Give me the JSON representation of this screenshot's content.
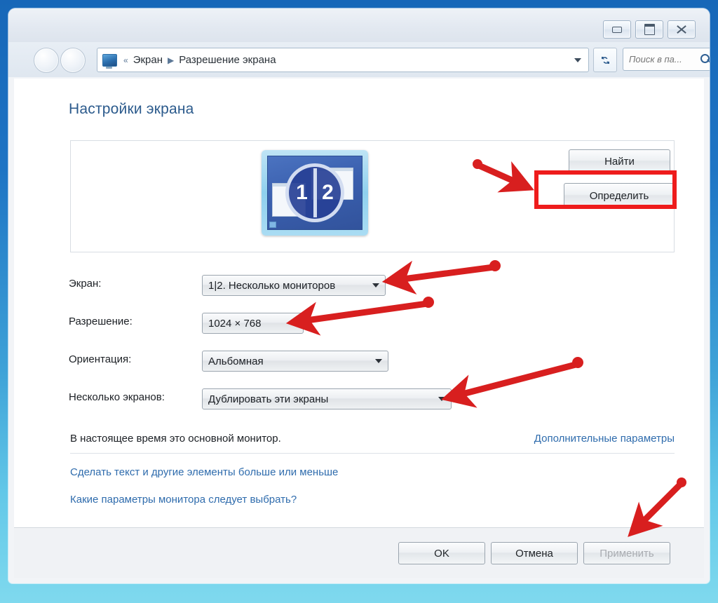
{
  "window": {
    "titlebar": {
      "minimize_label": "Свернуть",
      "maximize_label": "Развернуть",
      "close_label": "Закрыть"
    },
    "nav": {
      "back_label": "Назад",
      "forward_label": "Вперёд",
      "breadcrumb_prefix": "«",
      "breadcrumb": [
        "Экран",
        "Разрешение экрана"
      ],
      "breadcrumb_separator": "▶",
      "refresh_icon": "refresh-icon",
      "address_icon": "display-icon"
    },
    "search": {
      "placeholder": "Поиск в па...",
      "value": "",
      "icon": "search-icon"
    }
  },
  "main": {
    "page_title": "Настройки экрана",
    "preview": {
      "badge_left": "1",
      "badge_right": "2"
    },
    "buttons": {
      "find": "Найти",
      "identify": "Определить"
    },
    "fields": [
      {
        "label": "Экран:",
        "value": "1|2. Несколько мониторов",
        "name": "display-select"
      },
      {
        "label": "Разрешение:",
        "value": "1024 × 768",
        "name": "resolution-select"
      },
      {
        "label": "Ориентация:",
        "value": "Альбомная",
        "name": "orientation-select"
      },
      {
        "label": "Несколько экранов:",
        "value": "Дублировать эти экраны",
        "name": "multiple-displays-select"
      }
    ],
    "primary_note": "В настоящее время это основной монитор.",
    "links": {
      "advanced": "Дополнительные параметры",
      "text_size": "Сделать текст и другие элементы больше или меньше",
      "which_settings": "Какие параметры монитора следует выбрать?"
    }
  },
  "footer": {
    "ok": "OK",
    "cancel": "Отмена",
    "apply": "Применить"
  },
  "annotations": {
    "highlight_color": "#ee1c1c",
    "arrow_color": "#d81f1f",
    "arrow_count": 5
  },
  "colors": {
    "desktop_top": "#1767b8",
    "desktop_bottom": "#7fd9ee",
    "heading": "#2b5a8c",
    "link": "#2f6cad"
  }
}
